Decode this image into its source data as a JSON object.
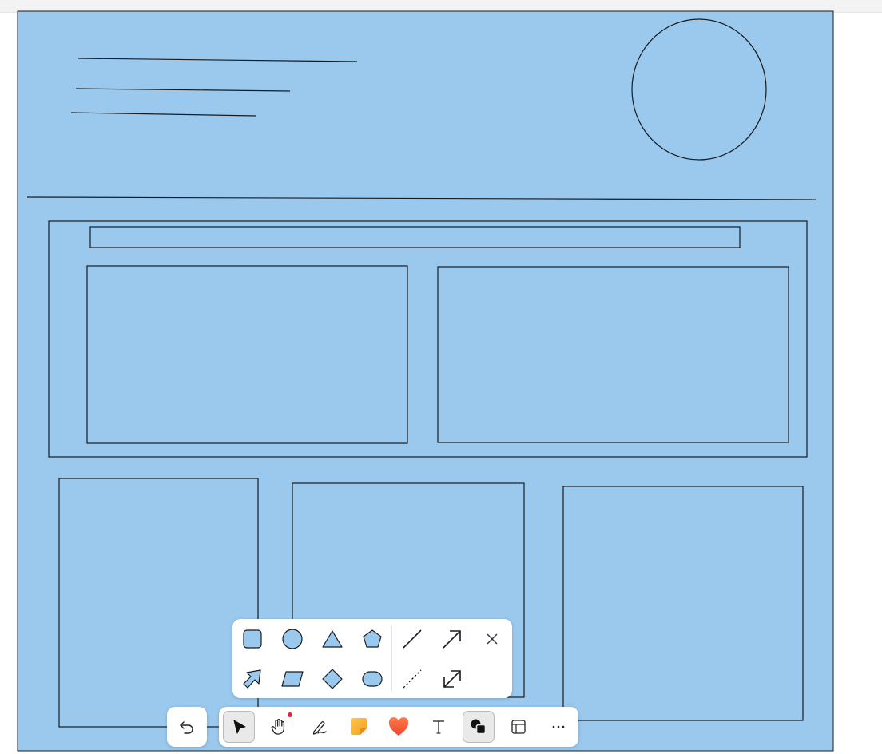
{
  "app": {
    "type": "whiteboard-editor"
  },
  "colors": {
    "frame_fill": "#9bc9ee",
    "stroke": "#1a1a1a",
    "shape_fill": "#9bc9ee",
    "toolbar_bg": "#ffffff",
    "active_tool_bg": "#e9e9e9",
    "sticky_note": "#f7b731",
    "heart": "#f5563f",
    "notification_dot": "#e0243a"
  },
  "canvas": {
    "frame": {
      "present": true
    },
    "drawn_elements": [
      "line",
      "line",
      "line",
      "circle",
      "divider-line",
      "outer-rectangle",
      "header-bar-rectangle",
      "left-panel-rectangle",
      "right-panel-rectangle",
      "bottom-left-rectangle",
      "bottom-middle-rectangle",
      "bottom-right-rectangle"
    ]
  },
  "shape_palette": {
    "shapes": [
      {
        "name": "rectangle",
        "icon": "rounded-square-icon"
      },
      {
        "name": "ellipse",
        "icon": "circle-icon"
      },
      {
        "name": "triangle",
        "icon": "triangle-icon"
      },
      {
        "name": "pentagon",
        "icon": "pentagon-icon"
      },
      {
        "name": "arrow-shape",
        "icon": "arrow-shape-icon"
      },
      {
        "name": "parallelogram",
        "icon": "parallelogram-icon"
      },
      {
        "name": "diamond",
        "icon": "diamond-icon"
      },
      {
        "name": "pill",
        "icon": "pill-icon"
      }
    ],
    "connectors": [
      {
        "name": "line",
        "icon": "line-icon"
      },
      {
        "name": "arrow",
        "icon": "arrow-icon"
      },
      {
        "name": "dashed-line",
        "icon": "dashed-line-icon"
      },
      {
        "name": "double-arrow",
        "icon": "double-arrow-icon"
      }
    ],
    "close": {
      "icon": "close-icon"
    }
  },
  "toolbar": {
    "undo": {
      "icon": "undo-icon"
    },
    "tools": [
      {
        "name": "select",
        "icon": "cursor-icon",
        "active": false
      },
      {
        "name": "hand",
        "icon": "hand-icon",
        "has_notification": true
      },
      {
        "name": "pen",
        "icon": "pen-icon"
      },
      {
        "name": "sticky-note",
        "icon": "sticky-note-icon"
      },
      {
        "name": "sticker",
        "icon": "heart-icon"
      },
      {
        "name": "text",
        "icon": "text-icon",
        "glyph": "T"
      },
      {
        "name": "shapes",
        "icon": "shapes-icon",
        "active": true
      },
      {
        "name": "frame",
        "icon": "frame-icon"
      },
      {
        "name": "more",
        "icon": "more-icon",
        "glyph": "···"
      }
    ]
  }
}
